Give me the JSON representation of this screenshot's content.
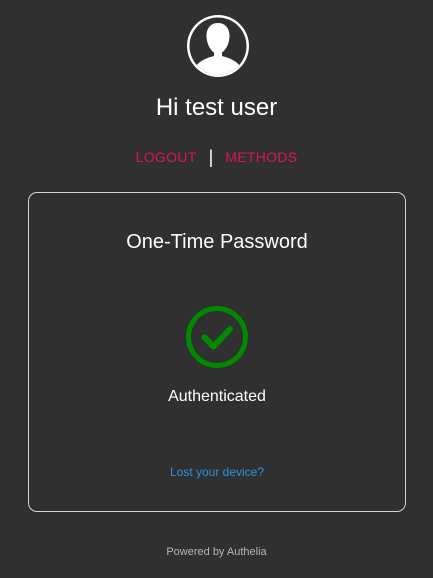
{
  "header": {
    "avatar_icon": "user-silhouette-icon",
    "greeting": "Hi test user"
  },
  "nav": {
    "logout_label": "LOGOUT",
    "separator": "|",
    "methods_label": "METHODS"
  },
  "card": {
    "title": "One-Time Password",
    "status_icon": "check-circle-icon",
    "status_text": "Authenticated",
    "lost_device_link": "Lost your device?"
  },
  "footer": {
    "powered_by": "Powered by Authelia"
  },
  "colors": {
    "background": "#303030",
    "accent_link": "#e01553",
    "success": "#008a00",
    "link_blue": "#2f8fe0",
    "card_border": "#d6d6d6"
  }
}
